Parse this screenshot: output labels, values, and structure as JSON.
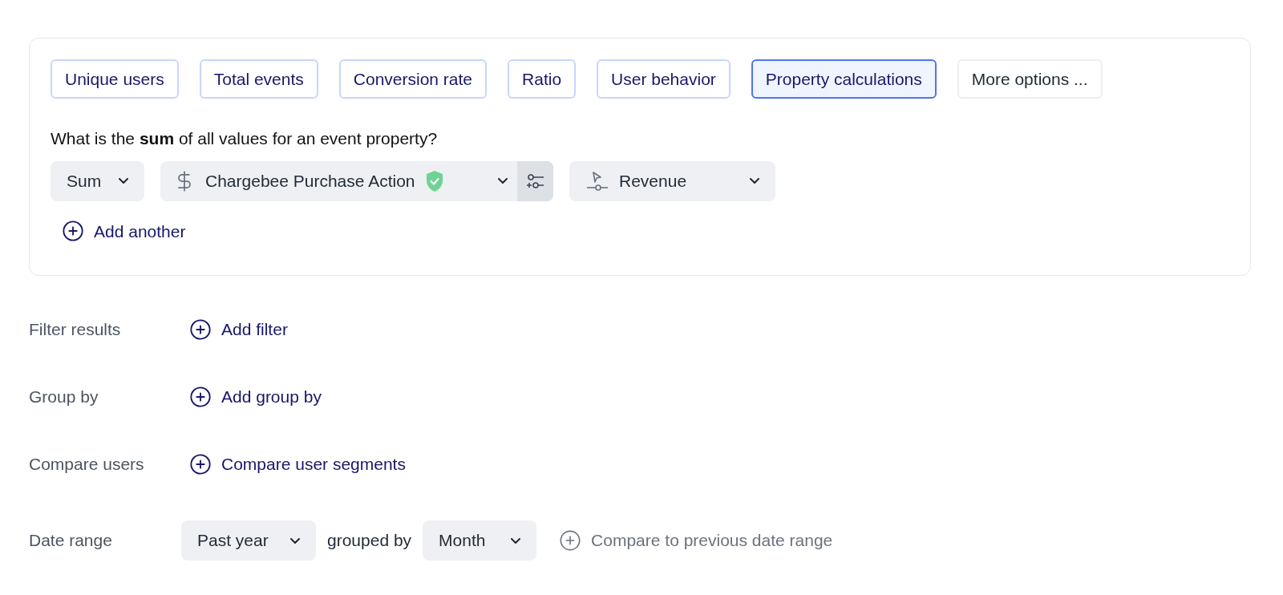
{
  "metric_tabs": [
    {
      "label": "Unique users",
      "selected": false,
      "kind": "metric"
    },
    {
      "label": "Total events",
      "selected": false,
      "kind": "metric"
    },
    {
      "label": "Conversion rate",
      "selected": false,
      "kind": "metric"
    },
    {
      "label": "Ratio",
      "selected": false,
      "kind": "metric"
    },
    {
      "label": "User behavior",
      "selected": false,
      "kind": "metric"
    },
    {
      "label": "Property calculations",
      "selected": true,
      "kind": "metric"
    },
    {
      "label": "More options ...",
      "selected": false,
      "kind": "more"
    }
  ],
  "question": "What is the **sum** of all values for an event property?",
  "aggregation": {
    "value": "Sum"
  },
  "event": {
    "value": "Chargebee Purchase Action",
    "verified": true
  },
  "property": {
    "value": "Revenue"
  },
  "add_another": "Add another",
  "rows": [
    {
      "label": "Filter results",
      "action": "Add filter"
    },
    {
      "label": "Group by",
      "action": "Add group by"
    },
    {
      "label": "Compare users",
      "action": "Compare user segments"
    }
  ],
  "date_range": {
    "label": "Date range",
    "range": "Past year",
    "connector": "grouped by",
    "interval": "Month",
    "compare": "Compare to previous date range"
  }
}
